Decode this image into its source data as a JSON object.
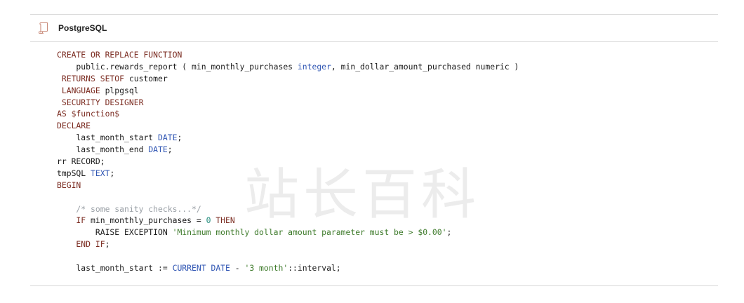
{
  "header": {
    "language_label": "PostgreSQL",
    "icon": "document-scroll-icon"
  },
  "colors": {
    "keyword": "#7a2a1f",
    "type": "#2f55b3",
    "comment": "#9aa0a6",
    "number": "#1e8a7a",
    "string": "#3d7a2a",
    "plain": "#1a1a1a",
    "border": "#d9d9d9"
  },
  "watermark": {
    "text": "站长百科"
  },
  "code": {
    "lines": [
      [
        {
          "t": "CREATE OR REPLACE FUNCTION",
          "c": "kw"
        }
      ],
      [
        {
          "t": "    public.rewards_report ( min_monthly_purchases ",
          "c": "pl"
        },
        {
          "t": "integer",
          "c": "ty"
        },
        {
          "t": ", min_dollar_amount_purchased numeric )",
          "c": "pl"
        }
      ],
      [
        {
          "t": " RETURNS SETOF ",
          "c": "kw"
        },
        {
          "t": "customer",
          "c": "pl"
        }
      ],
      [
        {
          "t": " LANGUAGE ",
          "c": "kw"
        },
        {
          "t": "plpgsql",
          "c": "pl"
        }
      ],
      [
        {
          "t": " SECURITY DESIGNER",
          "c": "kw"
        }
      ],
      [
        {
          "t": "AS ",
          "c": "kw"
        },
        {
          "t": "$function$",
          "c": "kw"
        }
      ],
      [
        {
          "t": "DECLARE",
          "c": "kw"
        }
      ],
      [
        {
          "t": "    last_month_start ",
          "c": "pl"
        },
        {
          "t": "DATE",
          "c": "ty"
        },
        {
          "t": ";",
          "c": "pl"
        }
      ],
      [
        {
          "t": "    last_month_end ",
          "c": "pl"
        },
        {
          "t": "DATE",
          "c": "ty"
        },
        {
          "t": ";",
          "c": "pl"
        }
      ],
      [
        {
          "t": "rr ",
          "c": "pl"
        },
        {
          "t": "RECORD",
          "c": "pl"
        },
        {
          "t": ";",
          "c": "pl"
        }
      ],
      [
        {
          "t": "tmpSQL ",
          "c": "pl"
        },
        {
          "t": "TEXT",
          "c": "ty"
        },
        {
          "t": ";",
          "c": "pl"
        }
      ],
      [
        {
          "t": "BEGIN",
          "c": "kw"
        }
      ],
      [
        {
          "t": "",
          "c": "pl"
        }
      ],
      [
        {
          "t": "    /* some sanity checks...*/",
          "c": "cm"
        }
      ],
      [
        {
          "t": "    IF ",
          "c": "kw"
        },
        {
          "t": "min_monthly_purchases = ",
          "c": "pl"
        },
        {
          "t": "0",
          "c": "nm"
        },
        {
          "t": " THEN",
          "c": "kw"
        }
      ],
      [
        {
          "t": "        RAISE EXCEPTION ",
          "c": "pl"
        },
        {
          "t": "'Minimum monthly dollar amount parameter must be > $0.00'",
          "c": "st"
        },
        {
          "t": ";",
          "c": "pl"
        }
      ],
      [
        {
          "t": "    END IF",
          "c": "kw"
        },
        {
          "t": ";",
          "c": "pl"
        }
      ],
      [
        {
          "t": "",
          "c": "pl"
        }
      ],
      [
        {
          "t": "    last_month_start := ",
          "c": "pl"
        },
        {
          "t": "CURRENT DATE",
          "c": "ty"
        },
        {
          "t": " - ",
          "c": "pl"
        },
        {
          "t": "'3 month'",
          "c": "st"
        },
        {
          "t": "::interval;",
          "c": "pl"
        }
      ]
    ]
  }
}
